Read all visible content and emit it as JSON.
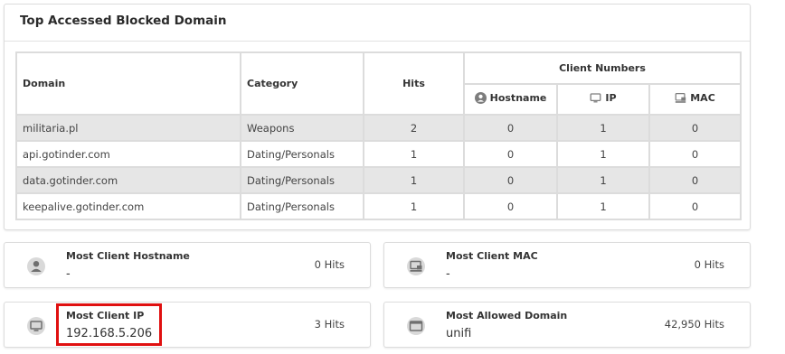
{
  "panel": {
    "title": "Top Accessed Blocked Domain",
    "columns": {
      "domain": "Domain",
      "category": "Category",
      "hits": "Hits",
      "client_numbers": "Client Numbers",
      "hostname": "Hostname",
      "ip": "IP",
      "mac": "MAC"
    },
    "rows": [
      {
        "domain": "militaria.pl",
        "category": "Weapons",
        "hits": "2",
        "hostname": "0",
        "ip": "1",
        "mac": "0"
      },
      {
        "domain": "api.gotinder.com",
        "category": "Dating/Personals",
        "hits": "1",
        "hostname": "0",
        "ip": "1",
        "mac": "0"
      },
      {
        "domain": "data.gotinder.com",
        "category": "Dating/Personals",
        "hits": "1",
        "hostname": "0",
        "ip": "1",
        "mac": "0"
      },
      {
        "domain": "keepalive.gotinder.com",
        "category": "Dating/Personals",
        "hits": "1",
        "hostname": "0",
        "ip": "1",
        "mac": "0"
      }
    ]
  },
  "cards": {
    "hostname": {
      "label": "Most Client Hostname",
      "value": "-",
      "hits": "0 Hits",
      "icon": "person-icon"
    },
    "mac": {
      "label": "Most Client MAC",
      "value": "-",
      "hits": "0 Hits",
      "icon": "network-card-icon"
    },
    "ip": {
      "label": "Most Client IP",
      "value": "192.168.5.206",
      "hits": "3 Hits",
      "icon": "monitor-icon"
    },
    "allowed": {
      "label": "Most Allowed Domain",
      "value": "unifi",
      "hits": "42,950 Hits",
      "icon": "browser-window-icon"
    }
  },
  "colors": {
    "highlight_border": "#e01010",
    "row_shade": "#e6e6e6",
    "icon_gray": "#7d7d7d"
  }
}
